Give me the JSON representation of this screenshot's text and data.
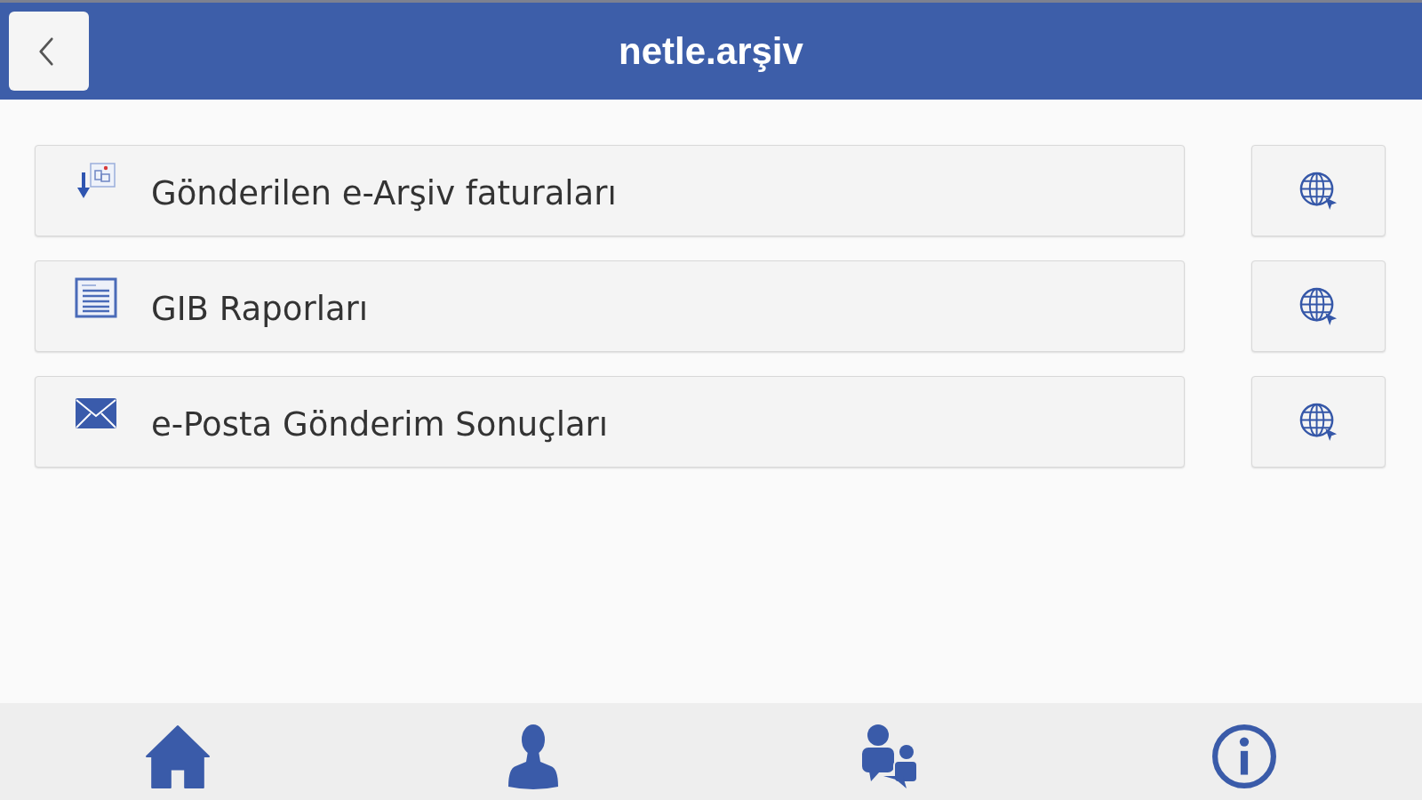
{
  "header": {
    "title": "netle.arşiv"
  },
  "menu_items": [
    {
      "label": "Gönderilen e-Arşiv faturaları",
      "kind": "invoices"
    },
    {
      "label": "GIB Raporları",
      "kind": "report"
    },
    {
      "label": "e-Posta Gönderim Sonuçları",
      "kind": "email"
    }
  ],
  "bottom_nav": [
    {
      "kind": "home"
    },
    {
      "kind": "person"
    },
    {
      "kind": "people-chat"
    },
    {
      "kind": "info"
    }
  ]
}
